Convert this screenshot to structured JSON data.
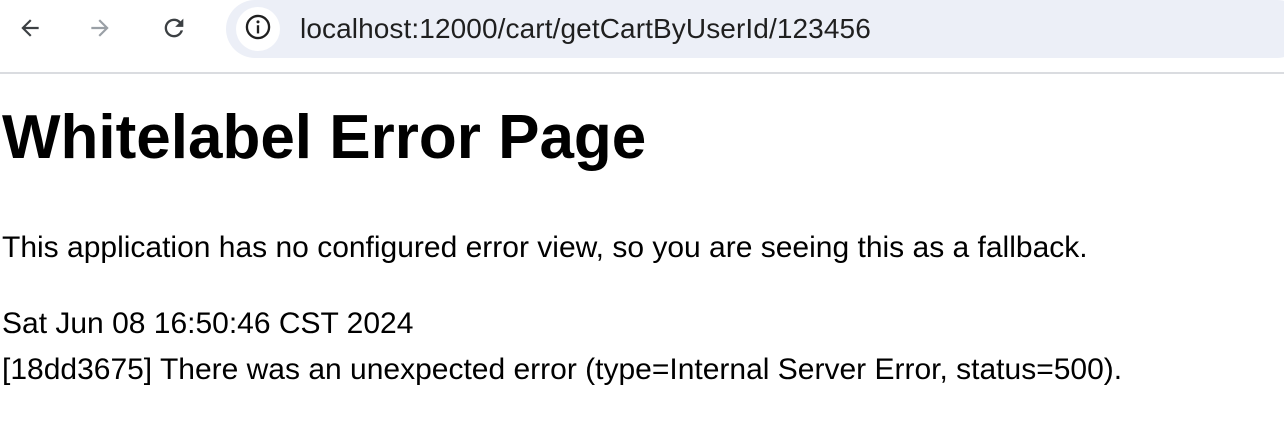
{
  "browser": {
    "url": "localhost:12000/cart/getCartByUserId/123456",
    "icons": {
      "back": "arrow-left-icon",
      "forward": "arrow-right-icon",
      "reload": "reload-icon",
      "site_info": "info-circle-icon"
    },
    "colors": {
      "omnibox_bg": "#eceff7",
      "forward_disabled": "#9aa0a6"
    }
  },
  "page": {
    "title": "Whitelabel Error Page",
    "description": "This application has no configured error view, so you are seeing this as a fallback.",
    "timestamp": "Sat Jun 08 16:50:46 CST 2024",
    "error_message": "[18dd3675] There was an unexpected error (type=Internal Server Error, status=500)."
  }
}
